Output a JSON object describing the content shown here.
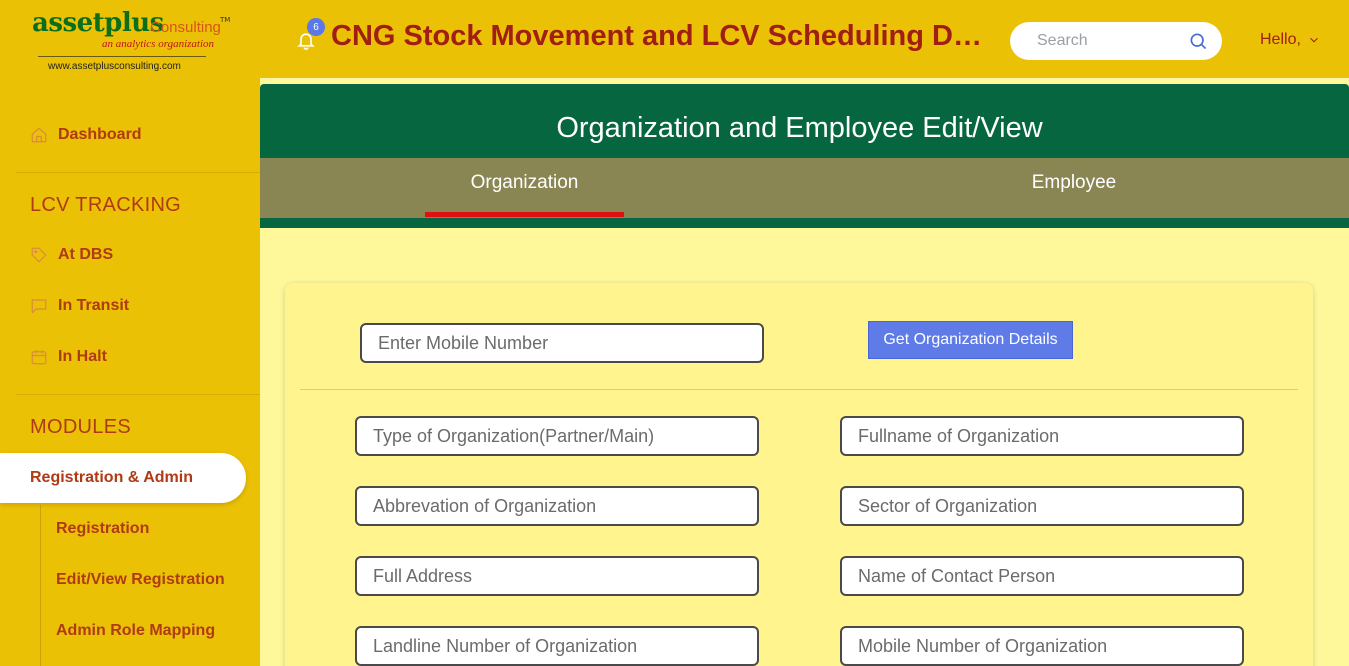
{
  "logo": {
    "brand": "assetplus",
    "consulting": "Consulting",
    "tm": "TM",
    "tagline": "an analytics organization",
    "url": "www.assetplusconsulting.com"
  },
  "header": {
    "notification_count": "6",
    "title": "CNG Stock Movement and LCV Scheduling Dashboard",
    "search_placeholder": "Search",
    "user_greeting": "Hello,"
  },
  "sidebar": {
    "dashboard": "Dashboard",
    "lcv_tracking_title": "LCV TRACKING",
    "lcv_items": [
      "At DBS",
      "In Transit",
      "In Halt"
    ],
    "modules_title": "MODULES",
    "active_module": "Registration & Admin",
    "sub_items": [
      "Registration",
      "Edit/View Registration",
      "Admin Role Mapping"
    ]
  },
  "page": {
    "title": "Organization and Employee Edit/View",
    "tabs": [
      "Organization",
      "Employee"
    ],
    "active_tab": "Organization"
  },
  "form": {
    "mobile_placeholder": "Enter Mobile Number",
    "get_details_button": "Get Organization Details",
    "fields": [
      "Type of Organization(Partner/Main)",
      "Fullname of Organization",
      "Abbrevation of Organization",
      "Sector of Organization",
      "Full Address",
      "Name of Contact Person",
      "Landline Number of Organization",
      "Mobile Number of Organization"
    ]
  },
  "colors": {
    "sidebar_bg": "#EBC106",
    "accent_red": "#A01E14",
    "banner_green": "#05663F",
    "tab_bar": "#8A8653",
    "tab_indicator": "#E01010",
    "content_bg": "#FFF89B",
    "button_blue": "#5F7BE8"
  }
}
